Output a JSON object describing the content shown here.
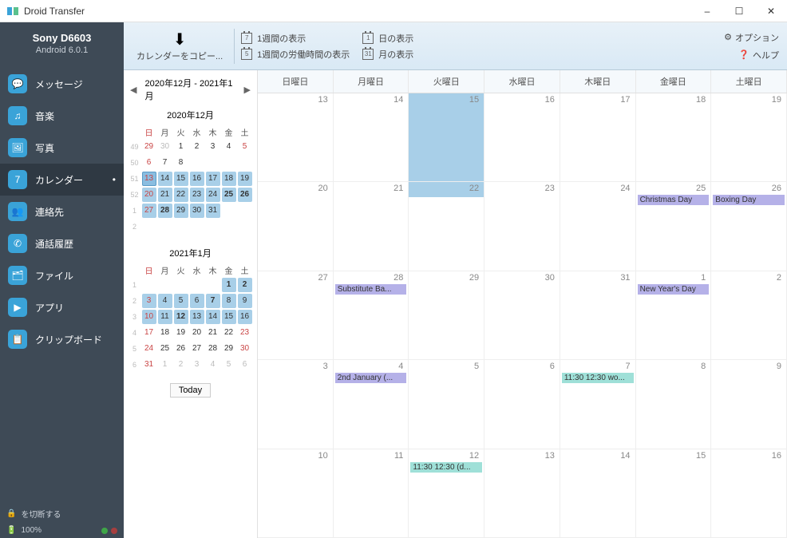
{
  "app": {
    "title": "Droid Transfer"
  },
  "window_buttons": {
    "min": "–",
    "max": "☐",
    "close": "✕"
  },
  "device": {
    "name": "Sony D6603",
    "os": "Android 6.0.1"
  },
  "sidebar": {
    "items": [
      {
        "label": "メッセージ",
        "icon": "💬"
      },
      {
        "label": "音楽",
        "icon": "♫"
      },
      {
        "label": "写真",
        "icon": "🖼"
      },
      {
        "label": "カレンダー",
        "icon": "7",
        "active": true
      },
      {
        "label": "連絡先",
        "icon": "👥"
      },
      {
        "label": "通話履歴",
        "icon": "✆"
      },
      {
        "label": "ファイル",
        "icon": "🗂"
      },
      {
        "label": "アプリ",
        "icon": "▶"
      },
      {
        "label": "クリップボード",
        "icon": "📋"
      }
    ],
    "footer": {
      "disconnect": "を切断する",
      "battery": "100%"
    }
  },
  "toolbar": {
    "copy": "カレンダーをコピー...",
    "view_week": "1週間の表示",
    "view_workweek": "1週間の労働時間の表示",
    "view_day": "日の表示",
    "view_month": "月の表示",
    "options": "オプション",
    "help": "ヘルプ"
  },
  "mini": {
    "range": "2020年12月 - 2021年1月",
    "today": "Today",
    "dow": [
      "日",
      "月",
      "火",
      "水",
      "木",
      "金",
      "土"
    ],
    "cal1": {
      "title": "2020年12月",
      "weeks": [
        {
          "wn": 49,
          "days": [
            {
              "n": 29,
              "o": 1,
              "s": 1
            },
            {
              "n": 30,
              "o": 1
            },
            {
              "n": 1
            },
            {
              "n": 2
            },
            {
              "n": 3
            },
            {
              "n": 4
            },
            {
              "n": 5,
              "s": 1
            }
          ]
        },
        {
          "wn": 50,
          "days": [
            {
              "n": 6,
              "s": 1
            },
            {
              "n": 7
            },
            {
              "n": 8
            },
            {
              "n": "",
              "e": 1
            },
            {
              "n": "",
              "e": 1
            },
            {
              "n": "",
              "e": 1
            },
            {
              "n": "",
              "e": 1
            }
          ]
        },
        {
          "wn": 51,
          "days": [
            {
              "n": 13,
              "sel": 2
            },
            {
              "n": 14,
              "sel": 1
            },
            {
              "n": 15,
              "sel": 1
            },
            {
              "n": 16,
              "sel": 1
            },
            {
              "n": 17,
              "sel": 1
            },
            {
              "n": 18,
              "sel": 1
            },
            {
              "n": 19,
              "sel": 1
            }
          ]
        },
        {
          "wn": 52,
          "days": [
            {
              "n": 20,
              "sel": 1
            },
            {
              "n": 21,
              "sel": 1
            },
            {
              "n": 22,
              "sel": 1
            },
            {
              "n": 23,
              "sel": 1
            },
            {
              "n": 24,
              "sel": 1
            },
            {
              "n": 25,
              "sel": 1,
              "b": 1
            },
            {
              "n": 26,
              "sel": 1,
              "b": 1
            }
          ]
        },
        {
          "wn": 1,
          "days": [
            {
              "n": 27,
              "sel": 1
            },
            {
              "n": 28,
              "sel": 1,
              "b": 1
            },
            {
              "n": 29,
              "sel": 1
            },
            {
              "n": 30,
              "sel": 1
            },
            {
              "n": 31,
              "sel": 1
            },
            {
              "n": "",
              "e": 1
            },
            {
              "n": "",
              "e": 1
            }
          ]
        },
        {
          "wn": 2,
          "days": [
            {
              "n": "",
              "e": 1
            },
            {
              "n": "",
              "e": 1
            },
            {
              "n": "",
              "e": 1
            },
            {
              "n": "",
              "e": 1
            },
            {
              "n": "",
              "e": 1
            },
            {
              "n": "",
              "e": 1
            },
            {
              "n": "",
              "e": 1
            }
          ]
        }
      ]
    },
    "cal2": {
      "title": "2021年1月",
      "weeks": [
        {
          "wn": 1,
          "days": [
            {
              "n": "",
              "e": 1
            },
            {
              "n": "",
              "e": 1
            },
            {
              "n": "",
              "e": 1
            },
            {
              "n": "",
              "e": 1
            },
            {
              "n": "",
              "e": 1
            },
            {
              "n": 1,
              "sel": 1,
              "b": 1
            },
            {
              "n": 2,
              "sel": 1,
              "b": 1
            }
          ]
        },
        {
          "wn": 2,
          "days": [
            {
              "n": 3,
              "sel": 1
            },
            {
              "n": 4,
              "sel": 1
            },
            {
              "n": 5,
              "sel": 1
            },
            {
              "n": 6,
              "sel": 1
            },
            {
              "n": 7,
              "sel": 1,
              "b": 1
            },
            {
              "n": 8,
              "sel": 1
            },
            {
              "n": 9,
              "sel": 1
            }
          ]
        },
        {
          "wn": 3,
          "days": [
            {
              "n": 10,
              "sel": 1
            },
            {
              "n": 11,
              "sel": 1
            },
            {
              "n": 12,
              "sel": 1,
              "b": 1
            },
            {
              "n": 13,
              "sel": 1
            },
            {
              "n": 14,
              "sel": 1
            },
            {
              "n": 15,
              "sel": 1
            },
            {
              "n": 16,
              "sel": 1
            }
          ]
        },
        {
          "wn": 4,
          "days": [
            {
              "n": 17,
              "s": 1
            },
            {
              "n": 18
            },
            {
              "n": 19
            },
            {
              "n": 20
            },
            {
              "n": 21
            },
            {
              "n": 22
            },
            {
              "n": 23,
              "s": 1
            }
          ]
        },
        {
          "wn": 5,
          "days": [
            {
              "n": 24,
              "s": 1
            },
            {
              "n": 25
            },
            {
              "n": 26
            },
            {
              "n": 27
            },
            {
              "n": 28
            },
            {
              "n": 29
            },
            {
              "n": 30,
              "s": 1
            }
          ]
        },
        {
          "wn": 6,
          "days": [
            {
              "n": 31,
              "s": 1
            },
            {
              "n": 1,
              "o": 1
            },
            {
              "n": 2,
              "o": 1
            },
            {
              "n": 3,
              "o": 1
            },
            {
              "n": 4,
              "o": 1
            },
            {
              "n": 5,
              "o": 1
            },
            {
              "n": 6,
              "o": 1
            }
          ]
        }
      ]
    }
  },
  "big": {
    "dow": [
      "日曜日",
      "月曜日",
      "火曜日",
      "水曜日",
      "木曜日",
      "金曜日",
      "土曜日"
    ],
    "weeks": [
      [
        {
          "d": 13
        },
        {
          "d": 14
        },
        {
          "d": 15,
          "hl": 1
        },
        {
          "d": 16
        },
        {
          "d": 17
        },
        {
          "d": 18
        },
        {
          "d": 19
        }
      ],
      [
        {
          "d": 20
        },
        {
          "d": 21
        },
        {
          "d": 22
        },
        {
          "d": 23
        },
        {
          "d": 24
        },
        {
          "d": 25,
          "ev": {
            "t": "Christmas Day",
            "c": "holiday"
          }
        },
        {
          "d": 26,
          "ev": {
            "t": "Boxing Day",
            "c": "holiday"
          }
        }
      ],
      [
        {
          "d": 27
        },
        {
          "d": 28,
          "ev": {
            "t": "Substitute Ba...",
            "c": "holiday"
          }
        },
        {
          "d": 29
        },
        {
          "d": 30
        },
        {
          "d": 31
        },
        {
          "d": 1,
          "ev": {
            "t": "New Year's Day",
            "c": "holiday"
          }
        },
        {
          "d": 2
        }
      ],
      [
        {
          "d": 3
        },
        {
          "d": 4,
          "ev": {
            "t": "2nd January (...",
            "c": "holiday"
          }
        },
        {
          "d": 5
        },
        {
          "d": 6
        },
        {
          "d": 7,
          "ev": {
            "t": "11:30  12:30 wo...",
            "c": "appt"
          }
        },
        {
          "d": 8
        },
        {
          "d": 9
        }
      ],
      [
        {
          "d": 10
        },
        {
          "d": 11
        },
        {
          "d": 12,
          "ev": {
            "t": "11:30  12:30  (d...",
            "c": "appt"
          }
        },
        {
          "d": 13
        },
        {
          "d": 14
        },
        {
          "d": 15
        },
        {
          "d": 16
        }
      ]
    ]
  }
}
